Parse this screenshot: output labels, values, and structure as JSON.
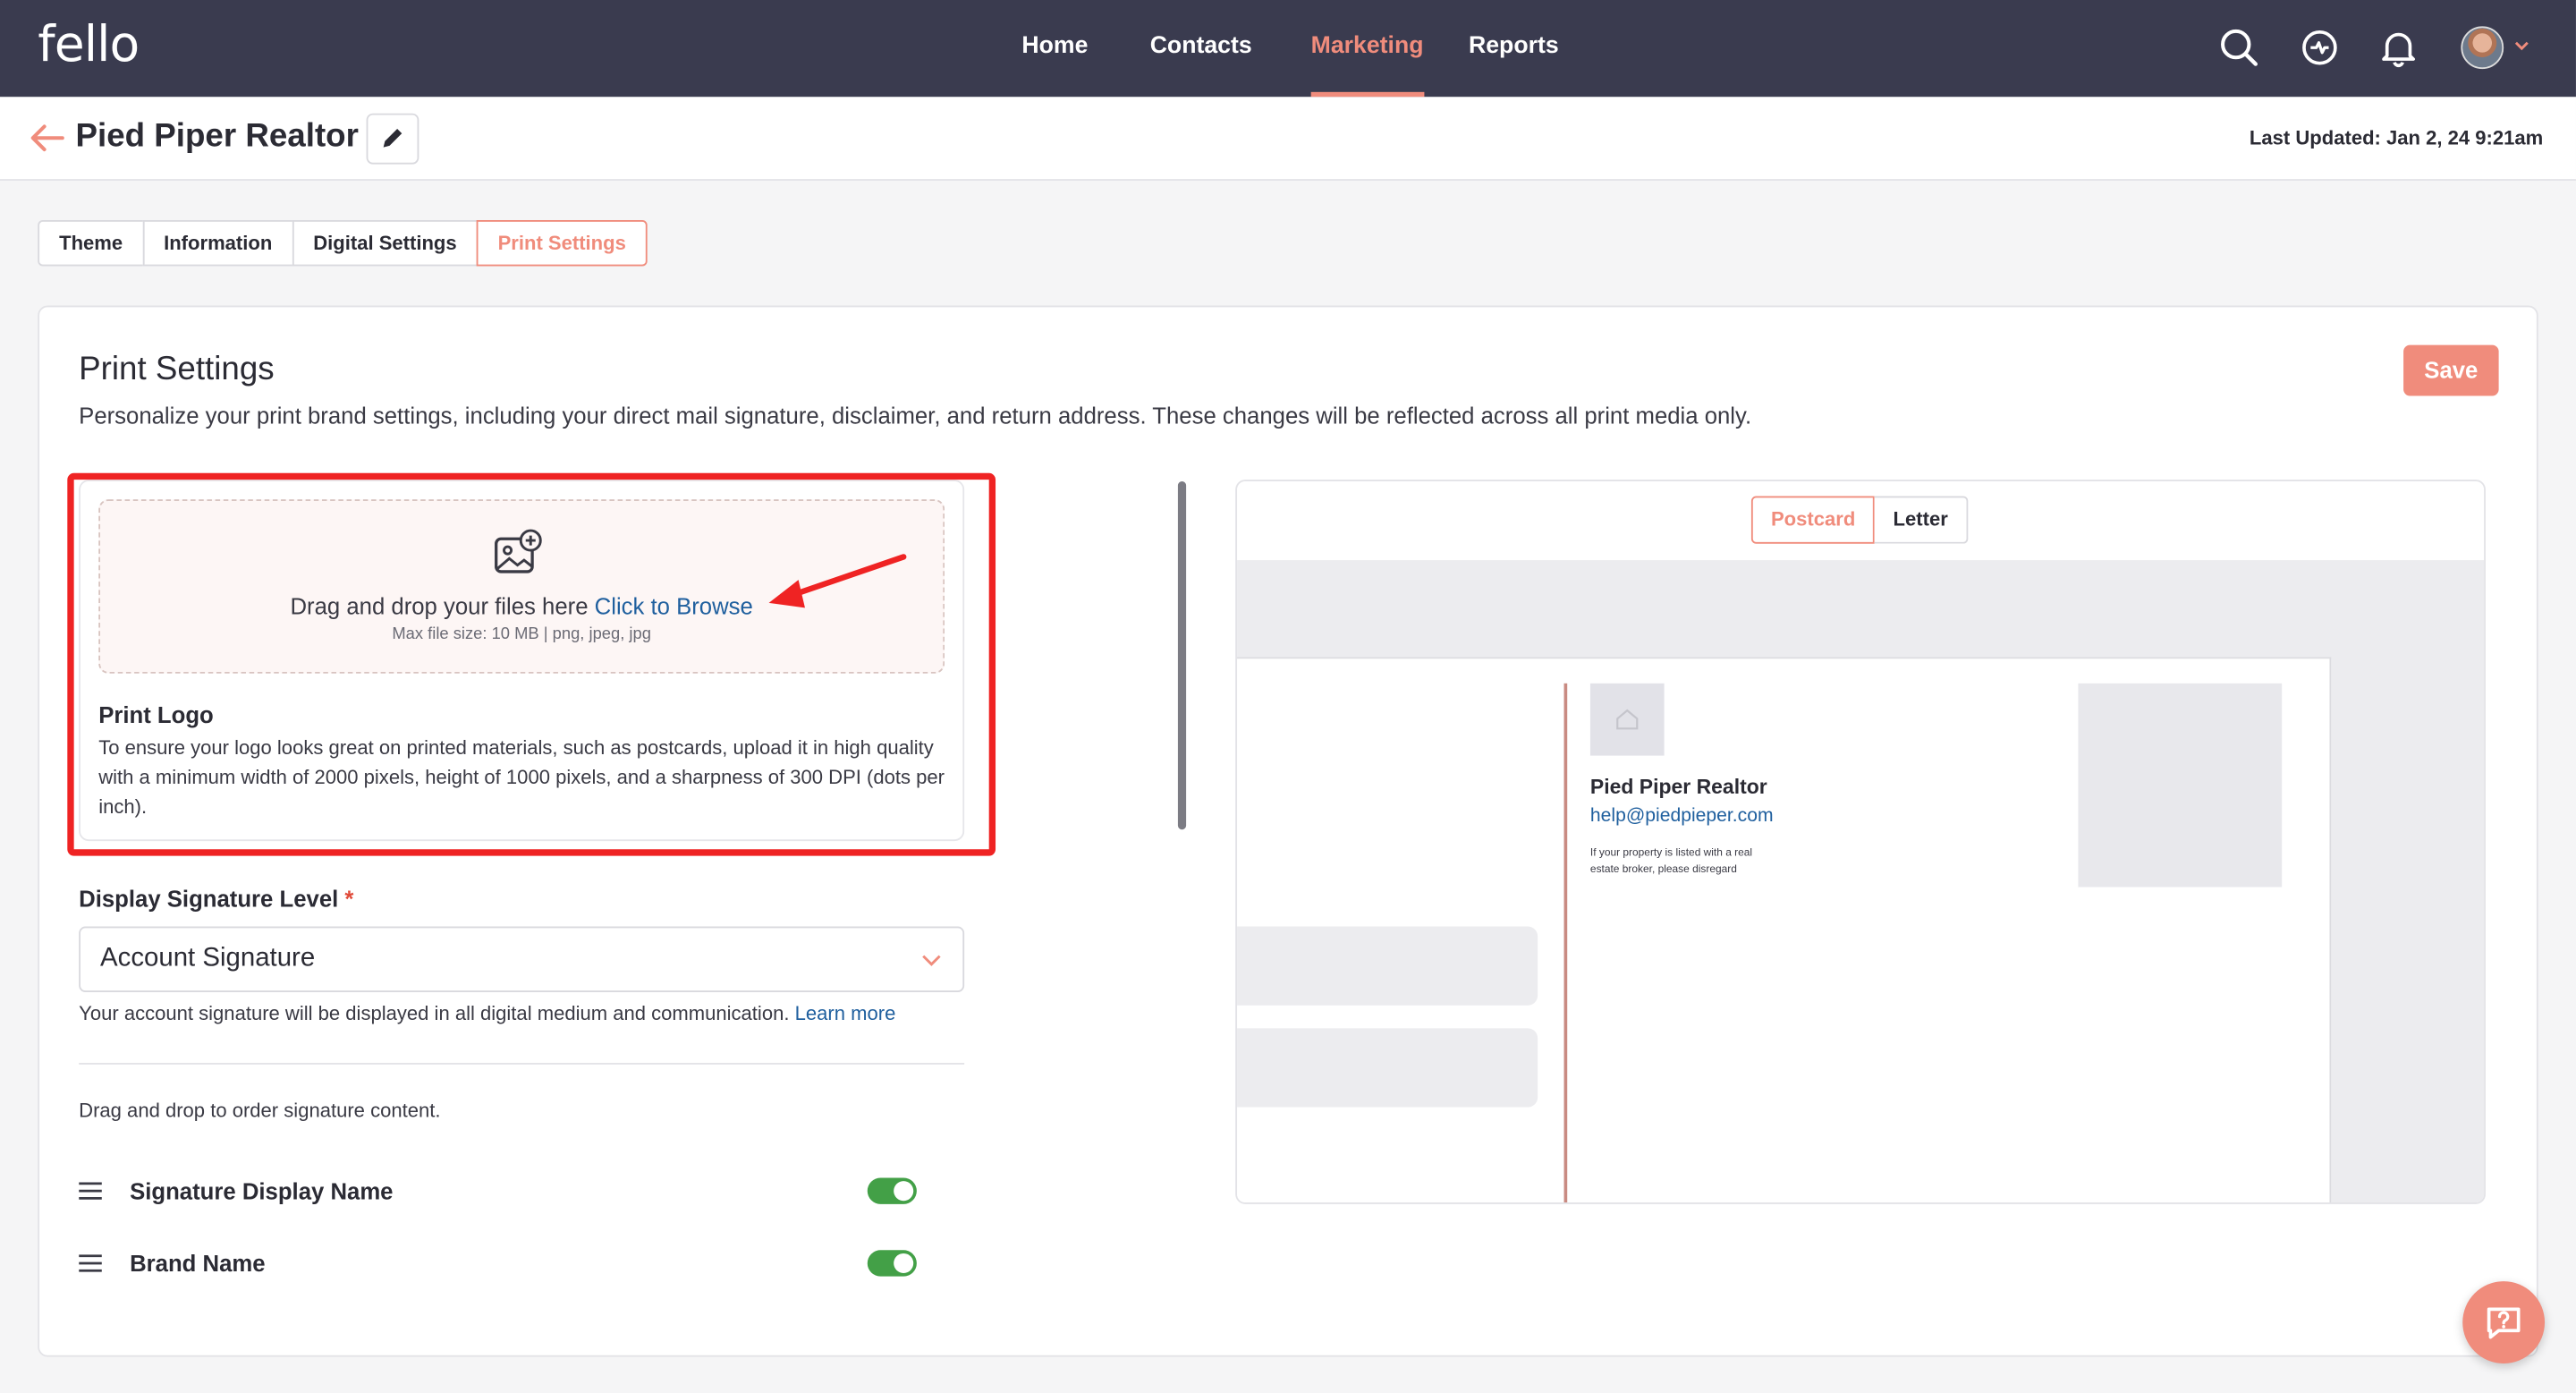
{
  "brand": {
    "logo_text": "fello",
    "accent": "#f08c7c",
    "topbar_bg": "#3a3b4f"
  },
  "nav": {
    "items": [
      {
        "label": "Home"
      },
      {
        "label": "Contacts"
      },
      {
        "label": "Marketing",
        "active": true
      },
      {
        "label": "Reports"
      }
    ],
    "icons": [
      "search-icon",
      "quick-action-icon",
      "bell-icon",
      "avatar"
    ]
  },
  "header": {
    "title": "Pied Piper Realtor",
    "last_updated": "Last Updated: Jan 2, 24 9:21am"
  },
  "tabs": [
    {
      "label": "Theme"
    },
    {
      "label": "Information"
    },
    {
      "label": "Digital Settings"
    },
    {
      "label": "Print Settings",
      "active": true
    }
  ],
  "print_settings": {
    "title": "Print Settings",
    "description": "Personalize your print brand settings, including your direct mail signature, disclaimer, and return address. These changes will be reflected across all print media only.",
    "save_label": "Save",
    "upload": {
      "text": "Drag and drop your files here",
      "browse_link": "Click to Browse",
      "limits": "Max file size: 10 MB | png, jpeg, jpg"
    },
    "print_logo": {
      "title": "Print Logo",
      "description": "To ensure your logo looks great on printed materials, such as postcards, upload it in high quality with a minimum width of 2000 pixels, height of 1000 pixels, and a sharpness of 300 DPI (dots per inch)."
    },
    "signature_level": {
      "label": "Display Signature Level",
      "required_mark": "*",
      "value": "Account Signature",
      "help": "Your account signature will be displayed in all digital medium and communication.",
      "help_link": "Learn more"
    },
    "order_help": "Drag and drop to order signature content.",
    "signature_items": [
      {
        "label": "Signature Display Name",
        "enabled": true
      },
      {
        "label": "Brand Name",
        "enabled": true
      }
    ]
  },
  "preview": {
    "modes": [
      {
        "label": "Postcard",
        "active": true
      },
      {
        "label": "Letter"
      }
    ],
    "postcard": {
      "name": "Pied Piper Realtor",
      "email": "help@piedpieper.com",
      "disclaimer": "If your property is listed with a real estate broker, please disregard"
    }
  }
}
